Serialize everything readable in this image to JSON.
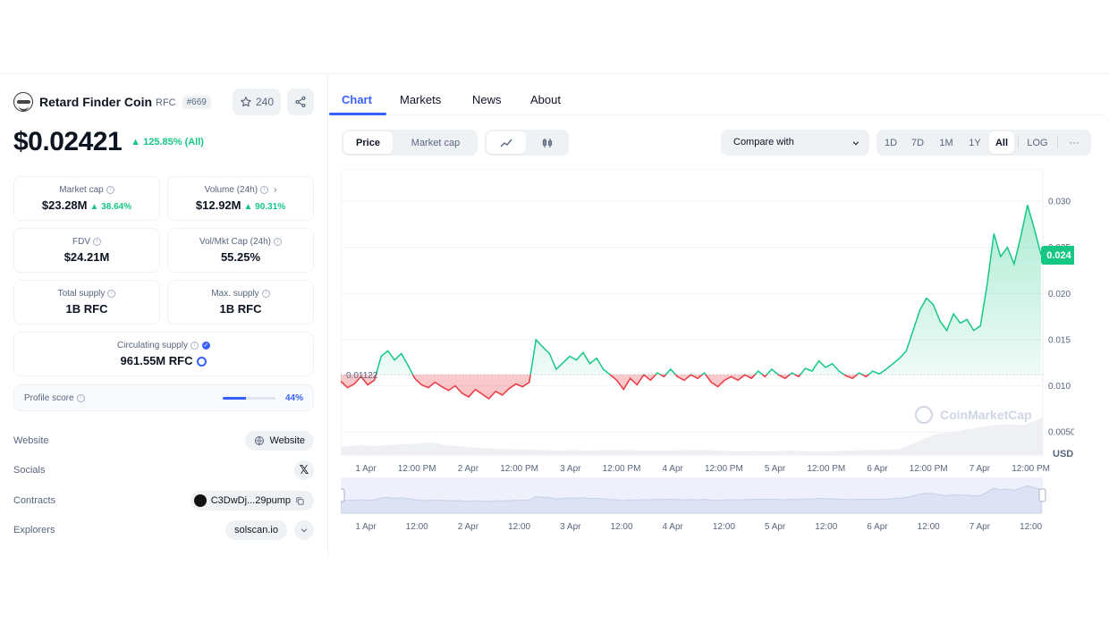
{
  "coin": {
    "name": "Retard Finder Coin",
    "symbol": "RFC",
    "rank": "#669",
    "watchlist_count": "240",
    "price": "$0.02421",
    "price_change": "125.85% (All)"
  },
  "stats": [
    {
      "label": "Market cap",
      "value": "$23.28M",
      "change": "38.64%"
    },
    {
      "label": "Volume (24h)",
      "value": "$12.92M",
      "change": "90.31%"
    },
    {
      "label": "FDV",
      "value": "$24.21M",
      "change": ""
    },
    {
      "label": "Vol/Mkt Cap (24h)",
      "value": "55.25%",
      "change": ""
    },
    {
      "label": "Total supply",
      "value": "1B RFC",
      "change": ""
    },
    {
      "label": "Max. supply",
      "value": "1B RFC",
      "change": ""
    },
    {
      "label": "Circulating supply",
      "value": "961.55M RFC",
      "change": ""
    }
  ],
  "profile": {
    "label": "Profile score",
    "pct_text": "44%",
    "fraction": 0.44
  },
  "links": {
    "website_label": "Website",
    "website_button": "Website",
    "socials_label": "Socials",
    "contracts_label": "Contracts",
    "contract_value": "C3DwDj...29pump",
    "explorers_label": "Explorers",
    "explorer_value": "solscan.io"
  },
  "tabs": [
    "Chart",
    "Markets",
    "News",
    "About"
  ],
  "toolbar": {
    "price": "Price",
    "market_cap": "Market cap",
    "compare": "Compare with",
    "ranges": [
      "1D",
      "7D",
      "1M",
      "1Y",
      "All"
    ],
    "log": "LOG",
    "more": "···"
  },
  "colors": {
    "accent": "#3861fb",
    "up": "#16c784",
    "down": "#ea3943"
  },
  "chart_data": {
    "type": "line",
    "y_ticks": [
      "0.030",
      "0.025",
      "0.020",
      "0.015",
      "0.010",
      "0.0050"
    ],
    "ylim": [
      0.0025,
      0.0335
    ],
    "currency": "USD",
    "current_label": "0.024",
    "reference_label": "0.01122",
    "reference": 0.01122,
    "watermark": "CoinMarketCap",
    "x_labels": [
      "1 Apr",
      "12:00 PM",
      "2 Apr",
      "12:00 PM",
      "3 Apr",
      "12:00 PM",
      "4 Apr",
      "12:00 PM",
      "5 Apr",
      "12:00 PM",
      "6 Apr",
      "12:00 PM",
      "7 Apr",
      "12:00 PM"
    ],
    "nav_labels": [
      "1 Apr",
      "12:00",
      "2 Apr",
      "12:00",
      "3 Apr",
      "12:00",
      "4 Apr",
      "12:00",
      "5 Apr",
      "12:00",
      "6 Apr",
      "12:00",
      "7 Apr",
      "12:00"
    ],
    "series": [
      {
        "values": [
          0.0105,
          0.0098,
          0.0102,
          0.011,
          0.0101,
          0.0106,
          0.0132,
          0.0138,
          0.0128,
          0.0135,
          0.0122,
          0.0108,
          0.0101,
          0.0098,
          0.0104,
          0.0099,
          0.0095,
          0.01,
          0.0092,
          0.0088,
          0.0096,
          0.0091,
          0.0086,
          0.0094,
          0.009,
          0.0097,
          0.0102,
          0.0099,
          0.0104,
          0.015,
          0.0142,
          0.0135,
          0.0118,
          0.0125,
          0.0132,
          0.0128,
          0.0136,
          0.0124,
          0.013,
          0.0118,
          0.0112,
          0.0106,
          0.0096,
          0.0108,
          0.0101,
          0.0112,
          0.0106,
          0.0114,
          0.011,
          0.0118,
          0.011,
          0.0106,
          0.0112,
          0.0108,
          0.0114,
          0.0104,
          0.0099,
          0.0106,
          0.011,
          0.0106,
          0.0112,
          0.0108,
          0.0116,
          0.011,
          0.0118,
          0.0112,
          0.0108,
          0.0114,
          0.011,
          0.0119,
          0.0116,
          0.0127,
          0.012,
          0.0124,
          0.0116,
          0.0111,
          0.0108,
          0.0114,
          0.011,
          0.0116,
          0.0113,
          0.0118,
          0.0124,
          0.013,
          0.0138,
          0.016,
          0.0182,
          0.0195,
          0.0188,
          0.017,
          0.016,
          0.0178,
          0.0168,
          0.0172,
          0.016,
          0.0165,
          0.021,
          0.0265,
          0.024,
          0.025,
          0.0232,
          0.0262,
          0.0296,
          0.027,
          0.0242
        ]
      }
    ],
    "volume": [
      0.22,
      0.26,
      0.24,
      0.28,
      0.3,
      0.34,
      0.26,
      0.22,
      0.18,
      0.16,
      0.15,
      0.14,
      0.12,
      0.13,
      0.12,
      0.14,
      0.13,
      0.12,
      0.12,
      0.13,
      0.14,
      0.12,
      0.1,
      0.11,
      0.1,
      0.12,
      0.1,
      0.1,
      0.12,
      0.13,
      0.14,
      0.15,
      0.35,
      0.55,
      0.62,
      0.7,
      0.78,
      0.82,
      0.8,
      1.0
    ]
  }
}
